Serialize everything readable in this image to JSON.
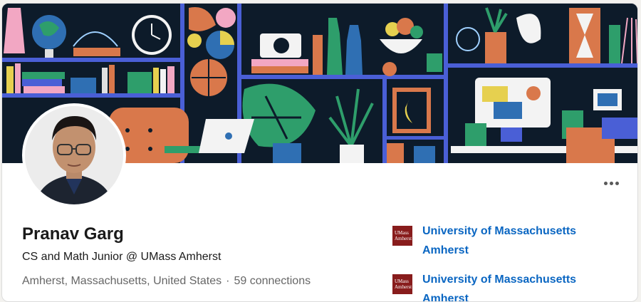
{
  "profile": {
    "name": "Pranav Garg",
    "headline": "CS and Math Junior @ UMass Amherst",
    "location": "Amherst, Massachusetts, United States",
    "separator": "·",
    "connections": "59 connections"
  },
  "education": [
    {
      "name": "University of Massachusetts Amherst",
      "logo_text": "UMass Amherst"
    },
    {
      "name": "University of Massachusetts Amherst",
      "logo_text": "UMass Amherst"
    }
  ],
  "colors": {
    "link": "#0a66c2",
    "umass_maroon": "#881c1c",
    "banner_bg": "#0d1b2a",
    "shelf_blue": "#4a5fd6"
  },
  "icons": {
    "more": "more-horizontal-icon",
    "school_logo": "umass-logo-icon"
  }
}
